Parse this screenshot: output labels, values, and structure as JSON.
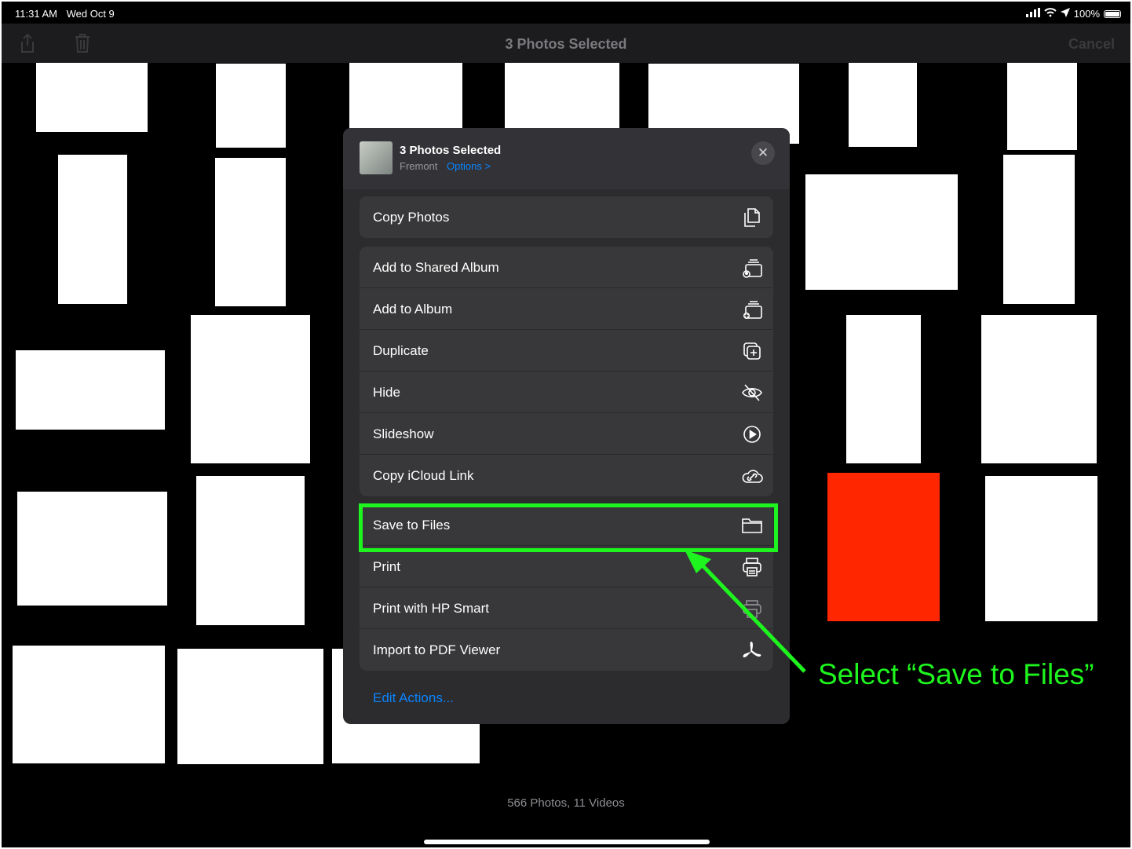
{
  "status_bar": {
    "time": "11:31 AM",
    "date": "Wed Oct 9",
    "battery": "100%"
  },
  "nav": {
    "title": "3 Photos Selected",
    "cancel": "Cancel"
  },
  "sheet": {
    "title": "3 Photos Selected",
    "location": "Fremont",
    "options": "Options >",
    "groups": [
      [
        {
          "label": "Copy Photos",
          "icon": "copy-icon"
        }
      ],
      [
        {
          "label": "Add to Shared Album",
          "icon": "shared-album-icon"
        },
        {
          "label": "Add to Album",
          "icon": "add-album-icon"
        },
        {
          "label": "Duplicate",
          "icon": "duplicate-icon"
        },
        {
          "label": "Hide",
          "icon": "eye-slash-icon"
        },
        {
          "label": "Slideshow",
          "icon": "play-circle-icon"
        },
        {
          "label": "Copy iCloud Link",
          "icon": "cloud-link-icon"
        }
      ],
      [
        {
          "label": "Save to Files",
          "icon": "folder-icon"
        },
        {
          "label": "Print",
          "icon": "printer-icon"
        },
        {
          "label": "Print with HP Smart",
          "icon": "hp-smart-icon"
        },
        {
          "label": "Import to PDF Viewer",
          "icon": "pdf-viewer-icon"
        }
      ]
    ],
    "edit_actions": "Edit Actions..."
  },
  "footer": {
    "count": "566 Photos, 11 Videos"
  },
  "annotation": {
    "text": "Select “Save to Files”",
    "color": "#1ef41e"
  },
  "colors": {
    "accent": "#0a84ff",
    "selected_photo": "#ff2600"
  }
}
